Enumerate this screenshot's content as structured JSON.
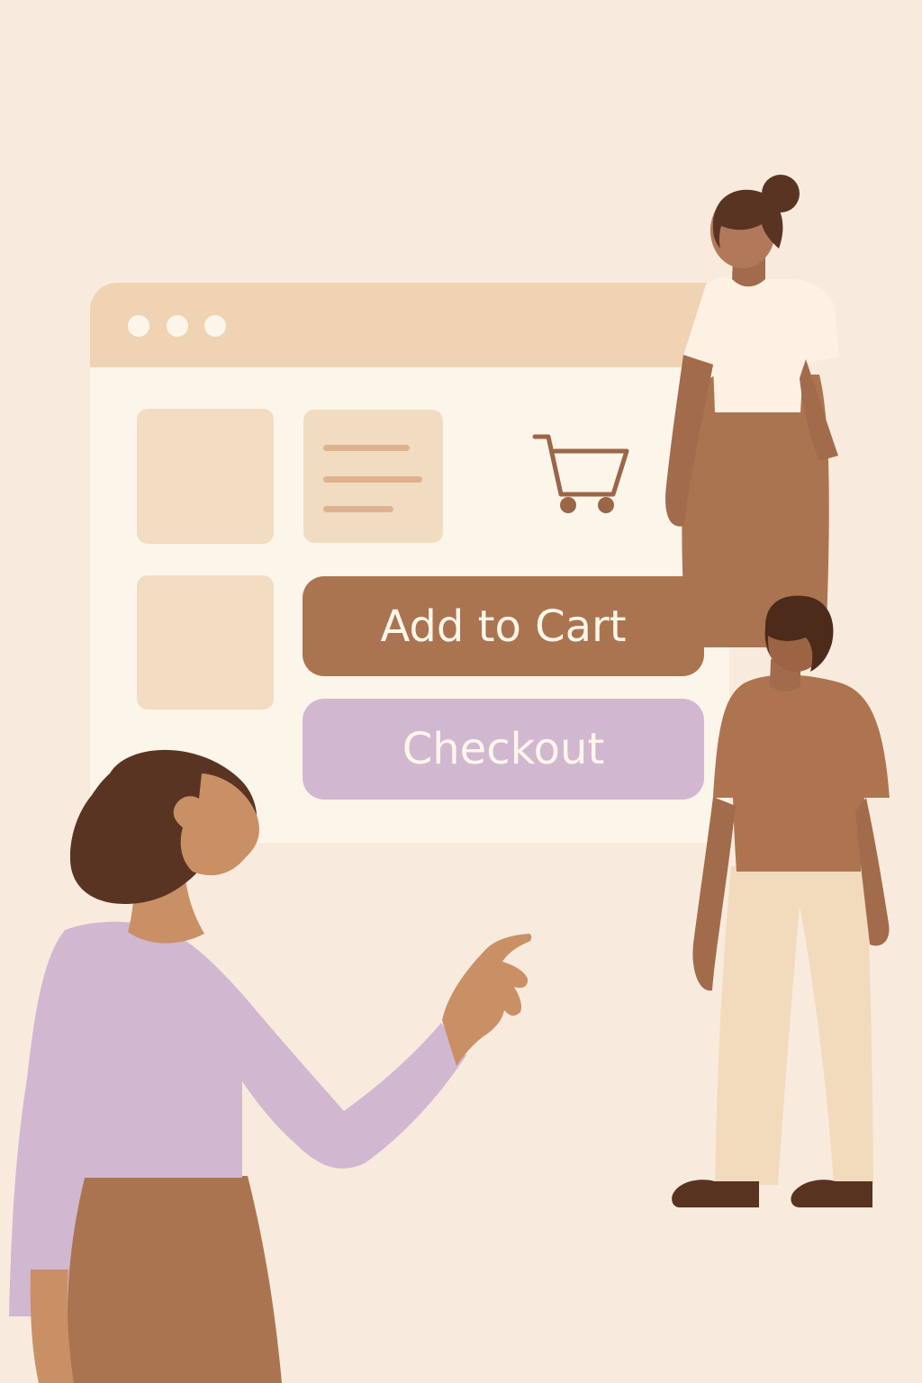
{
  "buttons": {
    "add_to_cart": "Add to Cart",
    "checkout": "Checkout"
  },
  "icons": {
    "cart": "shopping-cart-icon"
  },
  "colors": {
    "background": "#f8ebdd",
    "window": "#fcf5ea",
    "title_bar": "#efd3b3",
    "add_to_cart_button": "#ab7450",
    "checkout_button": "#d2b7d1",
    "cart_icon": "#9b6648"
  }
}
